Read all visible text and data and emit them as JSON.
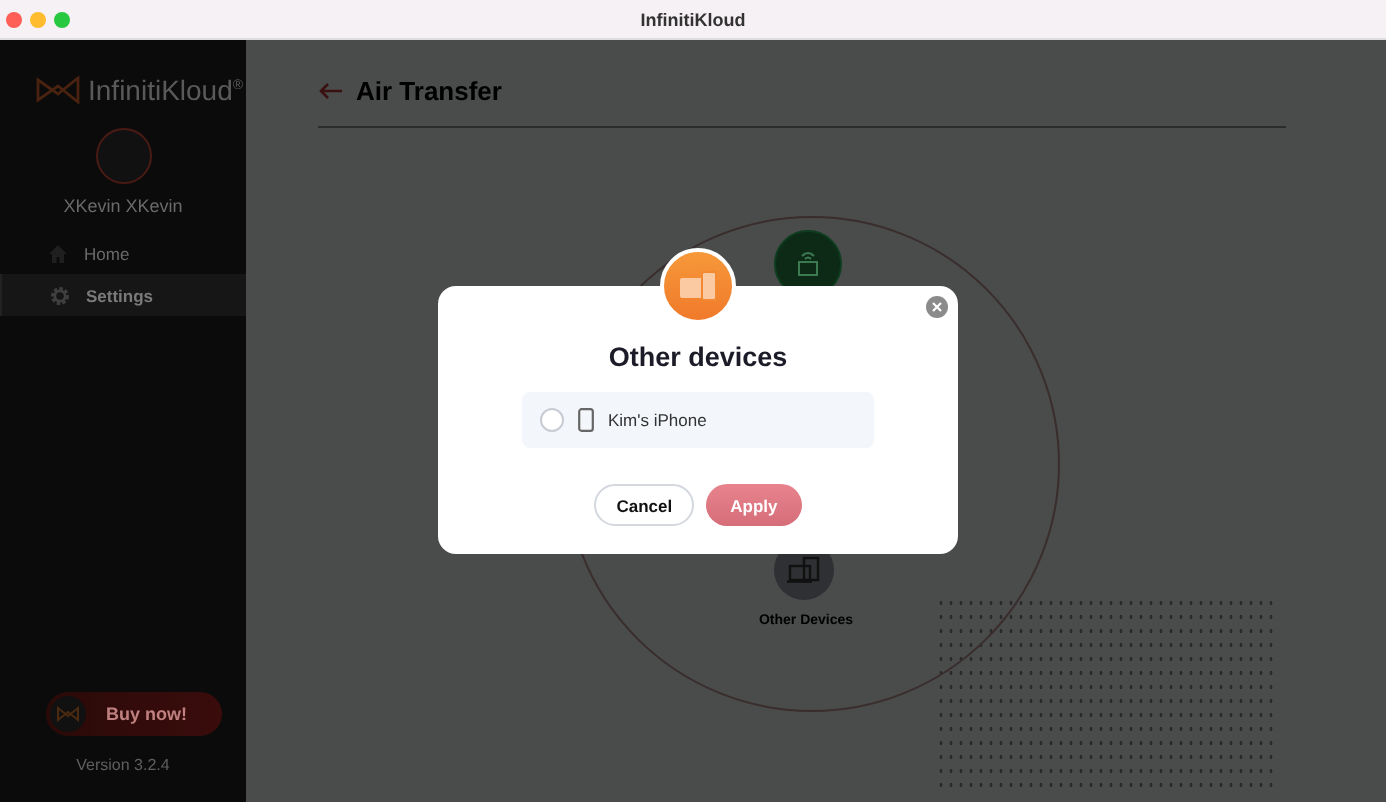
{
  "window": {
    "title": "InfinitiKloud"
  },
  "sidebar": {
    "logo": "InfinitiKloud",
    "logo_mark": "®",
    "user": "XKevin XKevin",
    "items": [
      {
        "label": "Home",
        "kind": "home",
        "selected": false
      },
      {
        "label": "Settings",
        "kind": "settings",
        "selected": true
      }
    ],
    "buy_button": "Buy now!",
    "version": "Version 3.2.4"
  },
  "page": {
    "title": "Air Transfer",
    "node_label": "Other Devices"
  },
  "dialog": {
    "title": "Other devices",
    "devices": [
      {
        "name": "Kim's iPhone",
        "selected": false
      }
    ],
    "buttons": [
      {
        "label": "Cancel",
        "kind": "secondary"
      },
      {
        "label": "Apply",
        "kind": "primary"
      }
    ]
  }
}
